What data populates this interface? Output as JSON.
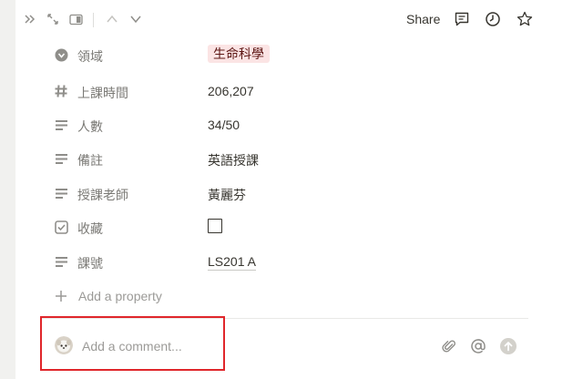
{
  "topbar": {
    "share_label": "Share",
    "left_icons": [
      "double-chevron-right-icon",
      "expand-icon",
      "side-peek-icon",
      "chevron-up-icon",
      "chevron-down-icon"
    ],
    "right_icons": [
      "comment-icon",
      "clock-icon",
      "star-icon"
    ]
  },
  "properties": [
    {
      "icon": "select-icon",
      "label": "領域",
      "value": "生命科學",
      "type": "tag",
      "tag_color": "#fbe4e4"
    },
    {
      "icon": "number-icon",
      "label": "上課時間",
      "value": "206,207",
      "type": "text"
    },
    {
      "icon": "text-icon",
      "label": "人數",
      "value": "34/50",
      "type": "text"
    },
    {
      "icon": "text-icon",
      "label": "備註",
      "value": "英語授課",
      "type": "text"
    },
    {
      "icon": "text-icon",
      "label": "授課老師",
      "value": "黃麗芬",
      "type": "text"
    },
    {
      "icon": "checkbox-icon",
      "label": "收藏",
      "value": "unchecked",
      "type": "checkbox"
    },
    {
      "icon": "text-icon",
      "label": "課號",
      "value": "LS201 A",
      "type": "text"
    }
  ],
  "add_property_label": "Add a property",
  "comment": {
    "placeholder": "Add a comment...",
    "actions": [
      "attachment-icon",
      "mention-icon",
      "send-icon"
    ]
  },
  "colors": {
    "highlight": "#e0262b",
    "tag_bg": "#fbe4e4",
    "tag_text": "#5d1715"
  }
}
